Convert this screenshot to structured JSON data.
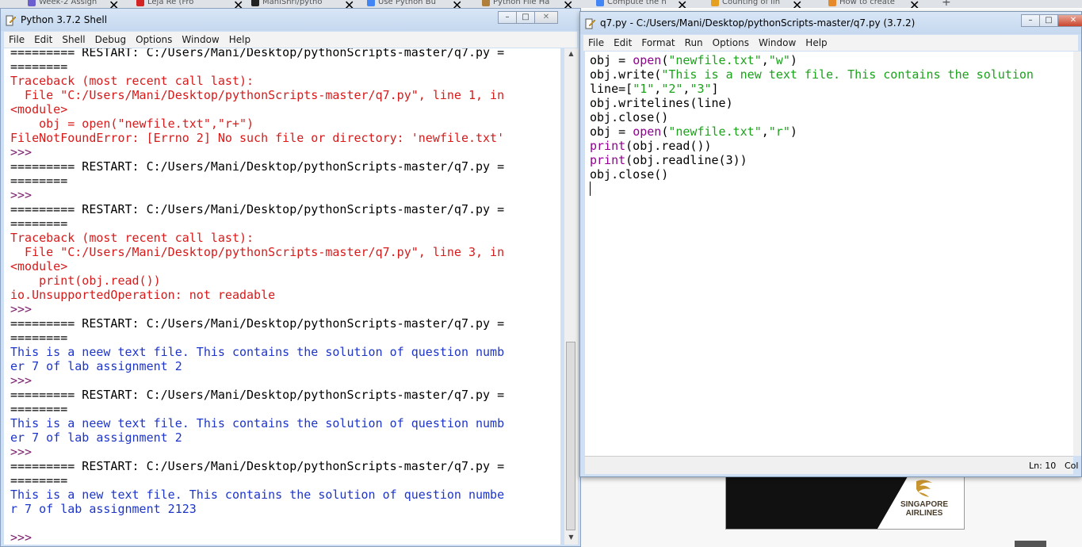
{
  "browser_tabs": [
    {
      "label": "Week-2 Assign",
      "color": "#6b5fcf"
    },
    {
      "label": "Leja Re (Fro",
      "color": "#d42323"
    },
    {
      "label": "ManiShri/pytho",
      "color": "#222222"
    },
    {
      "label": "Use Python Bu",
      "color": "#4285f4"
    },
    {
      "label": "Python File Ha",
      "color": "#b0803a"
    },
    {
      "label": "Compute the n",
      "color": "#4285f4"
    },
    {
      "label": "Counting of lin",
      "color": "#e6a020"
    },
    {
      "label": "How to create",
      "color": "#e48a2a"
    }
  ],
  "new_tab_label": "+",
  "shell": {
    "title": "Python 3.7.2 Shell",
    "menu": [
      "File",
      "Edit",
      "Shell",
      "Debug",
      "Options",
      "Window",
      "Help"
    ],
    "lines": [
      {
        "text": "========= RESTART: C:/Users/Mani/Desktop/pythonScripts-master/q7.py =",
        "color": "c-blk"
      },
      {
        "text": "========",
        "color": "c-blk"
      },
      {
        "text": "Traceback (most recent call last):",
        "color": "c-red"
      },
      {
        "text": "  File \"C:/Users/Mani/Desktop/pythonScripts-master/q7.py\", line 1, in",
        "color": "c-red"
      },
      {
        "text": "<module>",
        "color": "c-red"
      },
      {
        "text": "    obj = open(\"newfile.txt\",\"r+\")",
        "color": "c-red"
      },
      {
        "text": "FileNotFoundError: [Errno 2] No such file or directory: 'newfile.txt'",
        "color": "c-red"
      },
      {
        "text": ">>> ",
        "color": "c-navy"
      },
      {
        "text": "========= RESTART: C:/Users/Mani/Desktop/pythonScripts-master/q7.py =",
        "color": "c-blk"
      },
      {
        "text": "========",
        "color": "c-blk"
      },
      {
        "text": ">>> ",
        "color": "c-navy"
      },
      {
        "text": "========= RESTART: C:/Users/Mani/Desktop/pythonScripts-master/q7.py =",
        "color": "c-blk"
      },
      {
        "text": "========",
        "color": "c-blk"
      },
      {
        "text": "Traceback (most recent call last):",
        "color": "c-red"
      },
      {
        "text": "  File \"C:/Users/Mani/Desktop/pythonScripts-master/q7.py\", line 3, in",
        "color": "c-red"
      },
      {
        "text": "<module>",
        "color": "c-red"
      },
      {
        "text": "    print(obj.read())",
        "color": "c-red"
      },
      {
        "text": "io.UnsupportedOperation: not readable",
        "color": "c-red"
      },
      {
        "text": ">>> ",
        "color": "c-navy"
      },
      {
        "text": "========= RESTART: C:/Users/Mani/Desktop/pythonScripts-master/q7.py =",
        "color": "c-blk"
      },
      {
        "text": "========",
        "color": "c-blk"
      },
      {
        "text": "This is a neew text file. This contains the solution of question numb",
        "color": "c-blue"
      },
      {
        "text": "er 7 of lab assignment 2",
        "color": "c-blue"
      },
      {
        "text": ">>> ",
        "color": "c-navy"
      },
      {
        "text": "========= RESTART: C:/Users/Mani/Desktop/pythonScripts-master/q7.py =",
        "color": "c-blk"
      },
      {
        "text": "========",
        "color": "c-blk"
      },
      {
        "text": "This is a neew text file. This contains the solution of question numb",
        "color": "c-blue"
      },
      {
        "text": "er 7 of lab assignment 2",
        "color": "c-blue"
      },
      {
        "text": ">>> ",
        "color": "c-navy"
      },
      {
        "text": "========= RESTART: C:/Users/Mani/Desktop/pythonScripts-master/q7.py =",
        "color": "c-blk"
      },
      {
        "text": "========",
        "color": "c-blk"
      },
      {
        "text": "This is a new text file. This contains the solution of question numbe",
        "color": "c-blue"
      },
      {
        "text": "r 7 of lab assignment 2123",
        "color": "c-blue"
      },
      {
        "text": "",
        "color": "c-blk"
      },
      {
        "text": ">>> ",
        "color": "c-navy"
      }
    ]
  },
  "editor": {
    "title": "q7.py - C:/Users/Mani/Desktop/pythonScripts-master/q7.py (3.7.2)",
    "menu": [
      "File",
      "Edit",
      "Format",
      "Run",
      "Options",
      "Window",
      "Help"
    ],
    "code": [
      [
        {
          "t": "obj = ",
          "c": "k-def"
        },
        {
          "t": "open",
          "c": "k-blt"
        },
        {
          "t": "(",
          "c": "k-def"
        },
        {
          "t": "\"newfile.txt\"",
          "c": "k-str"
        },
        {
          "t": ",",
          "c": "k-def"
        },
        {
          "t": "\"w\"",
          "c": "k-str"
        },
        {
          "t": ")",
          "c": "k-def"
        }
      ],
      [
        {
          "t": "obj.write(",
          "c": "k-def"
        },
        {
          "t": "\"This is a new text file. This contains the solution",
          "c": "k-str"
        }
      ],
      [
        {
          "t": "line=[",
          "c": "k-def"
        },
        {
          "t": "\"1\"",
          "c": "k-str"
        },
        {
          "t": ",",
          "c": "k-def"
        },
        {
          "t": "\"2\"",
          "c": "k-str"
        },
        {
          "t": ",",
          "c": "k-def"
        },
        {
          "t": "\"3\"",
          "c": "k-str"
        },
        {
          "t": "]",
          "c": "k-def"
        }
      ],
      [
        {
          "t": "obj.writelines(line)",
          "c": "k-def"
        }
      ],
      [
        {
          "t": "obj.close()",
          "c": "k-def"
        }
      ],
      [
        {
          "t": "obj = ",
          "c": "k-def"
        },
        {
          "t": "open",
          "c": "k-blt"
        },
        {
          "t": "(",
          "c": "k-def"
        },
        {
          "t": "\"newfile.txt\"",
          "c": "k-str"
        },
        {
          "t": ",",
          "c": "k-def"
        },
        {
          "t": "\"r\"",
          "c": "k-str"
        },
        {
          "t": ")",
          "c": "k-def"
        }
      ],
      [
        {
          "t": "print",
          "c": "k-blt"
        },
        {
          "t": "(obj.read())",
          "c": "k-def"
        }
      ],
      [
        {
          "t": "print",
          "c": "k-blt"
        },
        {
          "t": "(obj.readline(3))",
          "c": "k-def"
        }
      ],
      [
        {
          "t": "obj.close()",
          "c": "k-def"
        }
      ]
    ],
    "status_ln": "Ln: 10",
    "status_col": "Col"
  },
  "ad": {
    "brand_line1": "SINGAPORE",
    "brand_line2": "AIRLINES"
  },
  "window_buttons": {
    "minimize": "–",
    "maximize": "□",
    "close": "✕"
  }
}
